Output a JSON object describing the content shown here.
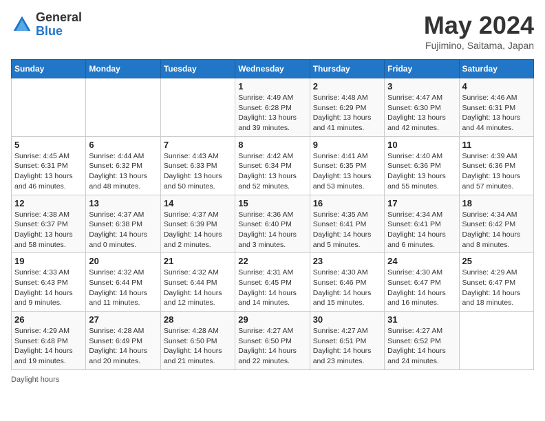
{
  "header": {
    "logo_general": "General",
    "logo_blue": "Blue",
    "month_title": "May 2024",
    "location": "Fujimino, Saitama, Japan"
  },
  "days_of_week": [
    "Sunday",
    "Monday",
    "Tuesday",
    "Wednesday",
    "Thursday",
    "Friday",
    "Saturday"
  ],
  "weeks": [
    [
      {
        "day": "",
        "info": ""
      },
      {
        "day": "",
        "info": ""
      },
      {
        "day": "",
        "info": ""
      },
      {
        "day": "1",
        "info": "Sunrise: 4:49 AM\nSunset: 6:28 PM\nDaylight: 13 hours\nand 39 minutes."
      },
      {
        "day": "2",
        "info": "Sunrise: 4:48 AM\nSunset: 6:29 PM\nDaylight: 13 hours\nand 41 minutes."
      },
      {
        "day": "3",
        "info": "Sunrise: 4:47 AM\nSunset: 6:30 PM\nDaylight: 13 hours\nand 42 minutes."
      },
      {
        "day": "4",
        "info": "Sunrise: 4:46 AM\nSunset: 6:31 PM\nDaylight: 13 hours\nand 44 minutes."
      }
    ],
    [
      {
        "day": "5",
        "info": "Sunrise: 4:45 AM\nSunset: 6:31 PM\nDaylight: 13 hours\nand 46 minutes."
      },
      {
        "day": "6",
        "info": "Sunrise: 4:44 AM\nSunset: 6:32 PM\nDaylight: 13 hours\nand 48 minutes."
      },
      {
        "day": "7",
        "info": "Sunrise: 4:43 AM\nSunset: 6:33 PM\nDaylight: 13 hours\nand 50 minutes."
      },
      {
        "day": "8",
        "info": "Sunrise: 4:42 AM\nSunset: 6:34 PM\nDaylight: 13 hours\nand 52 minutes."
      },
      {
        "day": "9",
        "info": "Sunrise: 4:41 AM\nSunset: 6:35 PM\nDaylight: 13 hours\nand 53 minutes."
      },
      {
        "day": "10",
        "info": "Sunrise: 4:40 AM\nSunset: 6:36 PM\nDaylight: 13 hours\nand 55 minutes."
      },
      {
        "day": "11",
        "info": "Sunrise: 4:39 AM\nSunset: 6:36 PM\nDaylight: 13 hours\nand 57 minutes."
      }
    ],
    [
      {
        "day": "12",
        "info": "Sunrise: 4:38 AM\nSunset: 6:37 PM\nDaylight: 13 hours\nand 58 minutes."
      },
      {
        "day": "13",
        "info": "Sunrise: 4:37 AM\nSunset: 6:38 PM\nDaylight: 14 hours\nand 0 minutes."
      },
      {
        "day": "14",
        "info": "Sunrise: 4:37 AM\nSunset: 6:39 PM\nDaylight: 14 hours\nand 2 minutes."
      },
      {
        "day": "15",
        "info": "Sunrise: 4:36 AM\nSunset: 6:40 PM\nDaylight: 14 hours\nand 3 minutes."
      },
      {
        "day": "16",
        "info": "Sunrise: 4:35 AM\nSunset: 6:41 PM\nDaylight: 14 hours\nand 5 minutes."
      },
      {
        "day": "17",
        "info": "Sunrise: 4:34 AM\nSunset: 6:41 PM\nDaylight: 14 hours\nand 6 minutes."
      },
      {
        "day": "18",
        "info": "Sunrise: 4:34 AM\nSunset: 6:42 PM\nDaylight: 14 hours\nand 8 minutes."
      }
    ],
    [
      {
        "day": "19",
        "info": "Sunrise: 4:33 AM\nSunset: 6:43 PM\nDaylight: 14 hours\nand 9 minutes."
      },
      {
        "day": "20",
        "info": "Sunrise: 4:32 AM\nSunset: 6:44 PM\nDaylight: 14 hours\nand 11 minutes."
      },
      {
        "day": "21",
        "info": "Sunrise: 4:32 AM\nSunset: 6:44 PM\nDaylight: 14 hours\nand 12 minutes."
      },
      {
        "day": "22",
        "info": "Sunrise: 4:31 AM\nSunset: 6:45 PM\nDaylight: 14 hours\nand 14 minutes."
      },
      {
        "day": "23",
        "info": "Sunrise: 4:30 AM\nSunset: 6:46 PM\nDaylight: 14 hours\nand 15 minutes."
      },
      {
        "day": "24",
        "info": "Sunrise: 4:30 AM\nSunset: 6:47 PM\nDaylight: 14 hours\nand 16 minutes."
      },
      {
        "day": "25",
        "info": "Sunrise: 4:29 AM\nSunset: 6:47 PM\nDaylight: 14 hours\nand 18 minutes."
      }
    ],
    [
      {
        "day": "26",
        "info": "Sunrise: 4:29 AM\nSunset: 6:48 PM\nDaylight: 14 hours\nand 19 minutes."
      },
      {
        "day": "27",
        "info": "Sunrise: 4:28 AM\nSunset: 6:49 PM\nDaylight: 14 hours\nand 20 minutes."
      },
      {
        "day": "28",
        "info": "Sunrise: 4:28 AM\nSunset: 6:50 PM\nDaylight: 14 hours\nand 21 minutes."
      },
      {
        "day": "29",
        "info": "Sunrise: 4:27 AM\nSunset: 6:50 PM\nDaylight: 14 hours\nand 22 minutes."
      },
      {
        "day": "30",
        "info": "Sunrise: 4:27 AM\nSunset: 6:51 PM\nDaylight: 14 hours\nand 23 minutes."
      },
      {
        "day": "31",
        "info": "Sunrise: 4:27 AM\nSunset: 6:52 PM\nDaylight: 14 hours\nand 24 minutes."
      },
      {
        "day": "",
        "info": ""
      }
    ]
  ],
  "footer": {
    "daylight_label": "Daylight hours"
  }
}
